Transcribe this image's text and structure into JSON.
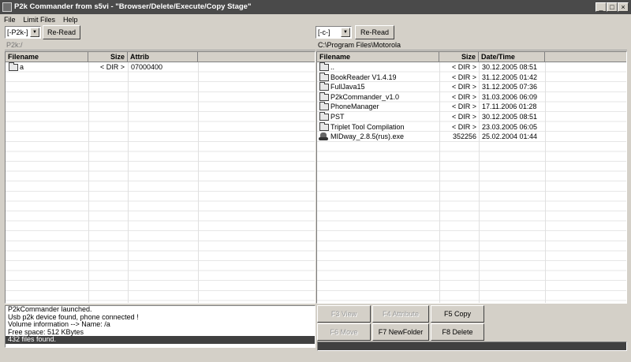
{
  "window": {
    "title": "P2k Commander from s5vi - \"Browser/Delete/Execute/Copy Stage\"",
    "controls": {
      "minimize": "_",
      "maximize": "□",
      "close": "×"
    }
  },
  "menu": [
    "File",
    "Limit Files",
    "Help"
  ],
  "left_panel": {
    "drive": "[-P2k-]",
    "reread": "Re-Read",
    "path": "P2k:/",
    "columns": [
      "Filename",
      "Size",
      "Attrib"
    ],
    "rows": [
      {
        "icon": "folder-icon",
        "name": "a",
        "size": "< DIR >",
        "attrib": "07000400"
      }
    ]
  },
  "right_panel": {
    "drive": "[-c-]",
    "reread": "Re-Read",
    "path": "C:\\Program Files\\Motorola",
    "columns": [
      "Filename",
      "Size",
      "Date/Time"
    ],
    "rows": [
      {
        "icon": "folder-icon",
        "name": "..",
        "size": "< DIR >",
        "date": "30.12.2005 08:51"
      },
      {
        "icon": "folder-icon",
        "name": "BookReader V1.4.19",
        "size": "< DIR >",
        "date": "31.12.2005 01:42"
      },
      {
        "icon": "folder-icon",
        "name": "FullJava15",
        "size": "< DIR >",
        "date": "31.12.2005 07:36"
      },
      {
        "icon": "folder-icon",
        "name": "P2kCommander_v1.0",
        "size": "< DIR >",
        "date": "31.03.2006 06:09"
      },
      {
        "icon": "folder-icon",
        "name": "PhoneManager",
        "size": "< DIR >",
        "date": "17.11.2006 01:28"
      },
      {
        "icon": "folder-icon",
        "name": "PST",
        "size": "< DIR >",
        "date": "30.12.2005 08:51"
      },
      {
        "icon": "folder-icon",
        "name": "Triplet Tool Compilation",
        "size": "< DIR >",
        "date": "23.03.2005 06:05"
      },
      {
        "icon": "exe-icon",
        "name": "MIDway_2.8.5(rus).exe",
        "size": "352256",
        "date": "25.02.2004 01:44"
      }
    ]
  },
  "log": [
    "P2kCommander launched.",
    "Usb p2k device found, phone connected !",
    "Volume information -->  Name: /a",
    "Free space: 512 KBytes",
    "432 files found."
  ],
  "function_buttons": {
    "f3": "F3  View",
    "f4": "F4     Attribute",
    "f5": "F5    Copy",
    "f6": "F6 Move",
    "f7": "F7 NewFolder",
    "f8": "F8 Delete"
  }
}
